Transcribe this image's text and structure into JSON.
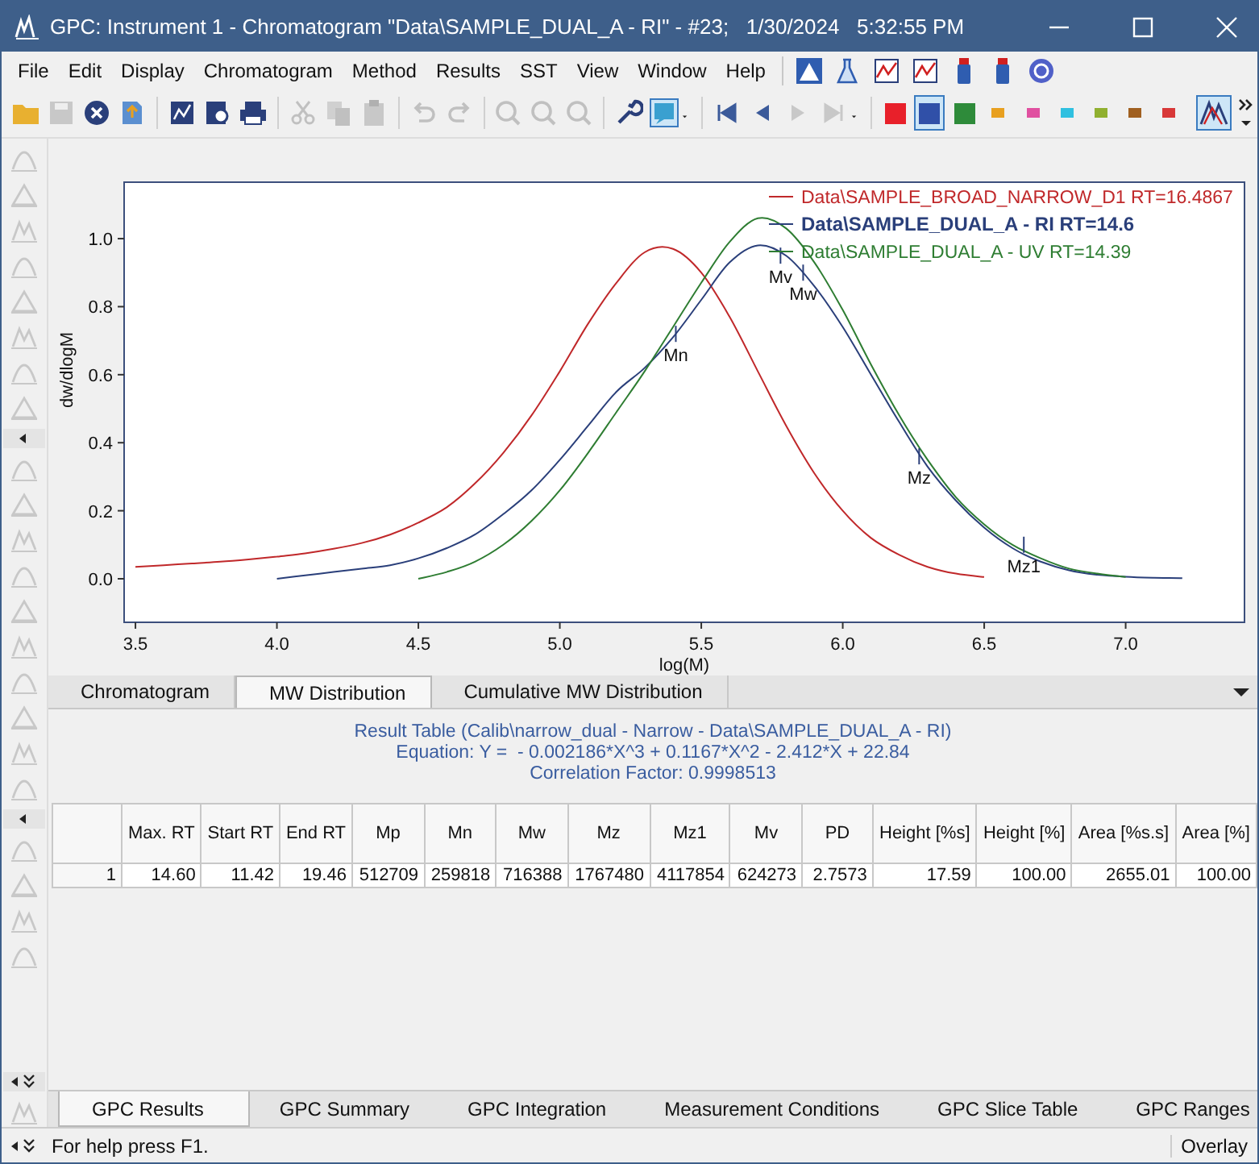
{
  "window": {
    "title": "GPC: Instrument 1 - Chromatogram \"Data\\SAMPLE_DUAL_A - RI\" - #23;   1/30/2024   5:32:55 PM"
  },
  "menu": [
    "File",
    "Edit",
    "Display",
    "Chromatogram",
    "Method",
    "Results",
    "SST",
    "View",
    "Window",
    "Help"
  ],
  "color_buttons": [
    {
      "color": "#e8202a",
      "selected": false,
      "kind": "large"
    },
    {
      "color": "#3050a8",
      "selected": true,
      "kind": "large"
    },
    {
      "color": "#2e8b3a",
      "selected": false,
      "kind": "large"
    },
    {
      "color": "#e8a020",
      "selected": false,
      "kind": "small"
    },
    {
      "color": "#e050a0",
      "selected": false,
      "kind": "small"
    },
    {
      "color": "#30c0e0",
      "selected": false,
      "kind": "small"
    },
    {
      "color": "#90b030",
      "selected": false,
      "kind": "small"
    },
    {
      "color": "#a06020",
      "selected": false,
      "kind": "small"
    },
    {
      "color": "#d83838",
      "selected": false,
      "kind": "small"
    }
  ],
  "chart": {
    "traces": [
      {
        "selected": false
      },
      {
        "selected": true
      },
      {
        "selected": false
      }
    ],
    "chart_data": {
      "type": "line",
      "xlabel": "log(M)",
      "ylabel": "dw/dlogM",
      "legend": "upper right",
      "x": [
        3.5,
        3.6,
        3.7,
        3.8,
        3.9,
        4.0,
        4.1,
        4.2,
        4.3,
        4.4,
        4.5,
        4.6,
        4.7,
        4.8,
        4.9,
        5.0,
        5.1,
        5.2,
        5.3,
        5.4,
        5.5,
        5.6,
        5.7,
        5.8,
        5.9,
        6.0,
        6.1,
        6.2,
        6.3,
        6.4,
        6.5,
        6.6,
        6.7,
        6.8,
        6.9,
        7.0,
        7.1,
        7.2
      ],
      "series": [
        {
          "name": "Data\\SAMPLE_BROAD_NARROW_D1 RT=16.4867",
          "color": "#c0282a",
          "values": [
            0.035,
            0.04,
            0.045,
            0.05,
            0.057,
            0.065,
            0.075,
            0.088,
            0.105,
            0.13,
            0.165,
            0.21,
            0.28,
            0.37,
            0.48,
            0.61,
            0.75,
            0.87,
            0.96,
            0.97,
            0.9,
            0.77,
            0.61,
            0.45,
            0.31,
            0.2,
            0.12,
            0.07,
            0.035,
            0.015,
            0.005,
            null,
            null,
            null,
            null,
            null,
            null,
            null
          ]
        },
        {
          "name": "Data\\SAMPLE_DUAL_A - RI RT=14.6",
          "color": "#2a3f7a",
          "values": [
            null,
            null,
            null,
            null,
            null,
            0.0,
            0.01,
            0.02,
            0.03,
            0.04,
            0.06,
            0.09,
            0.13,
            0.19,
            0.26,
            0.35,
            0.45,
            0.55,
            0.62,
            0.71,
            0.82,
            0.93,
            0.98,
            0.95,
            0.86,
            0.74,
            0.6,
            0.46,
            0.33,
            0.23,
            0.15,
            0.09,
            0.05,
            0.025,
            0.012,
            0.006,
            0.003,
            0.002
          ]
        },
        {
          "name": "Data\\SAMPLE_DUAL_A - UV RT=14.39",
          "color": "#2e7d32",
          "values": [
            null,
            null,
            null,
            null,
            null,
            null,
            null,
            null,
            null,
            null,
            0.0,
            0.02,
            0.05,
            0.1,
            0.17,
            0.26,
            0.37,
            0.49,
            0.61,
            0.74,
            0.87,
            0.99,
            1.06,
            1.03,
            0.93,
            0.79,
            0.63,
            0.48,
            0.35,
            0.24,
            0.16,
            0.1,
            0.06,
            0.03,
            0.015,
            0.005,
            null,
            null
          ]
        }
      ],
      "xlim": [
        3.46,
        7.42
      ],
      "ylim": [
        -0.128,
        1.166
      ],
      "xticks": [
        {
          "value": 3.5,
          "label": "3.5"
        },
        {
          "value": 4.0,
          "label": "4.0"
        },
        {
          "value": 4.5,
          "label": "4.5"
        },
        {
          "value": 5.0,
          "label": "5.0"
        },
        {
          "value": 5.5,
          "label": "5.5"
        },
        {
          "value": 6.0,
          "label": "6.0"
        },
        {
          "value": 6.5,
          "label": "6.5"
        },
        {
          "value": 7.0,
          "label": "7.0"
        }
      ],
      "yticks": [
        {
          "value": 0,
          "label": "0.0"
        },
        {
          "value": 0.2,
          "label": "0.2"
        },
        {
          "value": 0.4,
          "label": "0.4"
        },
        {
          "value": 0.6,
          "label": "0.6"
        },
        {
          "value": 0.8,
          "label": "0.8"
        },
        {
          "value": 1.0,
          "label": "1.0"
        }
      ],
      "annotations": [
        {
          "text": "Mn",
          "x": 5.41,
          "y": 0.72
        },
        {
          "text": "Mv",
          "x": 5.78,
          "y": 0.95
        },
        {
          "text": "Mw",
          "x": 5.86,
          "y": 0.9
        },
        {
          "text": "Mz",
          "x": 6.27,
          "y": 0.36
        },
        {
          "text": "Mz1",
          "x": 6.64,
          "y": 0.1
        }
      ]
    }
  },
  "view_tabs": [
    {
      "label": "Chromatogram",
      "selected": false
    },
    {
      "label": "MW Distribution",
      "selected": true
    },
    {
      "label": "Cumulative MW Distribution",
      "selected": false
    }
  ],
  "result": {
    "title": "Result Table (Calib\\narrow_dual - Narrow - Data\\SAMPLE_DUAL_A - RI)",
    "equation": "Equation: Y =  - 0.002186*X^3 + 0.1167*X^2 - 2.412*X + 22.84",
    "correlation": "Correlation Factor: 0.9998513",
    "columns": [
      "Max. RT",
      "Start RT",
      "End RT",
      "Mp",
      "Mn",
      "Mw",
      "Mz",
      "Mz1",
      "Mv",
      "PD",
      "Height [%s]",
      "Height [%]",
      "Area [%s.s]",
      "Area [%]"
    ],
    "rows": [
      {
        "index": "1",
        "cells": [
          "14.60",
          "11.42",
          "19.46",
          "512709",
          "259818",
          "716388",
          "1767480",
          "4117854",
          "624273",
          "2.7573",
          "17.59",
          "100.00",
          "2655.01",
          "100.00"
        ]
      }
    ]
  },
  "bottom_tabs": [
    {
      "label": "GPC Results",
      "selected": true
    },
    {
      "label": "GPC Summary",
      "selected": false
    },
    {
      "label": "GPC Integration",
      "selected": false
    },
    {
      "label": "Measurement Conditions",
      "selected": false
    },
    {
      "label": "GPC Slice Table",
      "selected": false
    },
    {
      "label": "GPC Ranges",
      "selected": false
    }
  ],
  "status_bar": {
    "help": "For help press F1.",
    "mode": "Overlay"
  }
}
